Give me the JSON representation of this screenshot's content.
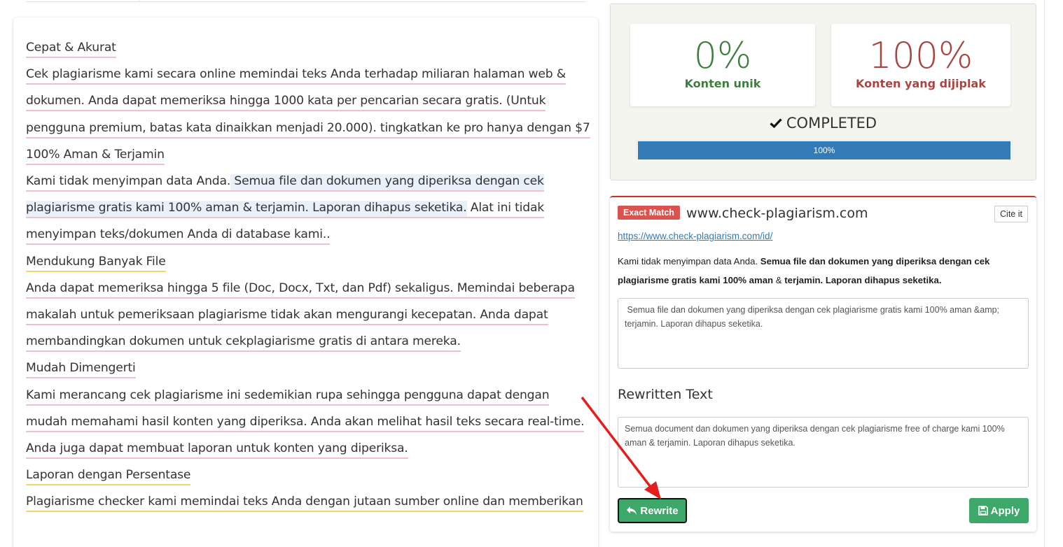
{
  "left_text": {
    "segments": [
      {
        "text": "Cepat & Akurat",
        "style": "pink"
      },
      {
        "br": true
      },
      {
        "text": "Cek plagiarisme kami secara online memindai teks Anda terhadap miliaran halaman web & dokumen. Anda dapat memeriksa hingga 1000 kata per pencarian secara gratis. (Untuk pengguna premium, batas kata dinaikkan menjadi 20.000).  tingkatkan ke pro hanya dengan $7",
        "style": "pink"
      },
      {
        "br": true
      },
      {
        "text": "100% Aman & Terjamin",
        "style": "pink"
      },
      {
        "br": true
      },
      {
        "text": "Kami tidak menyimpan data Anda.",
        "style": "pink"
      },
      {
        "text": " Semua file dan dokumen yang diperiksa dengan cek plagiarisme gratis kami 100% aman & terjamin. Laporan dihapus seketika.",
        "style": "highlight"
      },
      {
        "text": " Alat ini tidak menyimpan teks/dokumen Anda di database kami..",
        "style": "pink"
      },
      {
        "br": true
      },
      {
        "text": "Mendukung Banyak File",
        "style": "yellow"
      },
      {
        "br": true
      },
      {
        "text": "Anda dapat memeriksa hingga 5 file (Doc, Docx, Txt, dan Pdf) sekaligus. Memindai beberapa makalah untuk pemeriksaan plagiarisme tidak akan mengurangi kecepatan. Anda dapat membandingkan dokumen untuk cekplagiarisme gratis di antara mereka.",
        "style": "pink"
      },
      {
        "br": true
      },
      {
        "text": "Mudah Dimengerti",
        "style": "pink"
      },
      {
        "br": true
      },
      {
        "text": "Kami merancang cek plagiarisme ini sedemikian rupa sehingga pengguna dapat dengan mudah memahami hasil konten yang diperiksa. Anda akan melihat hasil teks secara real-time. Anda juga dapat membuat laporan untuk konten yang diperiksa.",
        "style": "pink"
      },
      {
        "br": true
      },
      {
        "text": "Laporan dengan Persentase",
        "style": "yellow"
      },
      {
        "br": true
      },
      {
        "text": "Plagiarisme checker kami memindai teks Anda dengan jutaan sumber online dan memberikan",
        "style": "yellow"
      }
    ]
  },
  "stats": {
    "unique_value": "0%",
    "unique_label": "Konten unik",
    "plag_value": "100%",
    "plag_label": "Konten yang dijiplak",
    "status": "COMPLETED",
    "progress_label": "100%",
    "progress_fraction": 1.0,
    "unique_color": "#3e7d3e",
    "plag_color": "#a94442",
    "progress_color": "#337ab7"
  },
  "match": {
    "badge": "Exact Match",
    "source": "www.check-plagiarism.com",
    "cite_label": "Cite it",
    "url": "https://www.check-plagiarism.com/id/",
    "text_plain_prefix": "Kami tidak menyimpan data Anda. ",
    "text_bold_1": "Semua file dan dokumen yang diperiksa dengan cek plagiarisme gratis kami 100% aman",
    "text_amp": " & ",
    "text_bold_2": "terjamin. Laporan dihapus seketika.",
    "original_text": " Semua file dan dokumen yang diperiksa dengan cek plagiarisme gratis kami 100% aman &amp; terjamin. Laporan dihapus seketika.",
    "rewritten_title": "Rewritten Text",
    "rewritten_text": "Semua document dan dokumen yang diperiksa dengan cek plagiarisme free of charge kami 100% aman & terjamin. Laporan dihapus seketika.",
    "rewrite_label": "Rewrite",
    "apply_label": "Apply",
    "badge_color": "#d9534f",
    "button_color": "#3ea86a"
  },
  "icons": {
    "check": "check-icon",
    "rewrite": "reply-arrow-icon",
    "apply": "floppy-disk-icon",
    "annotation": "red-arrow-annotation"
  }
}
